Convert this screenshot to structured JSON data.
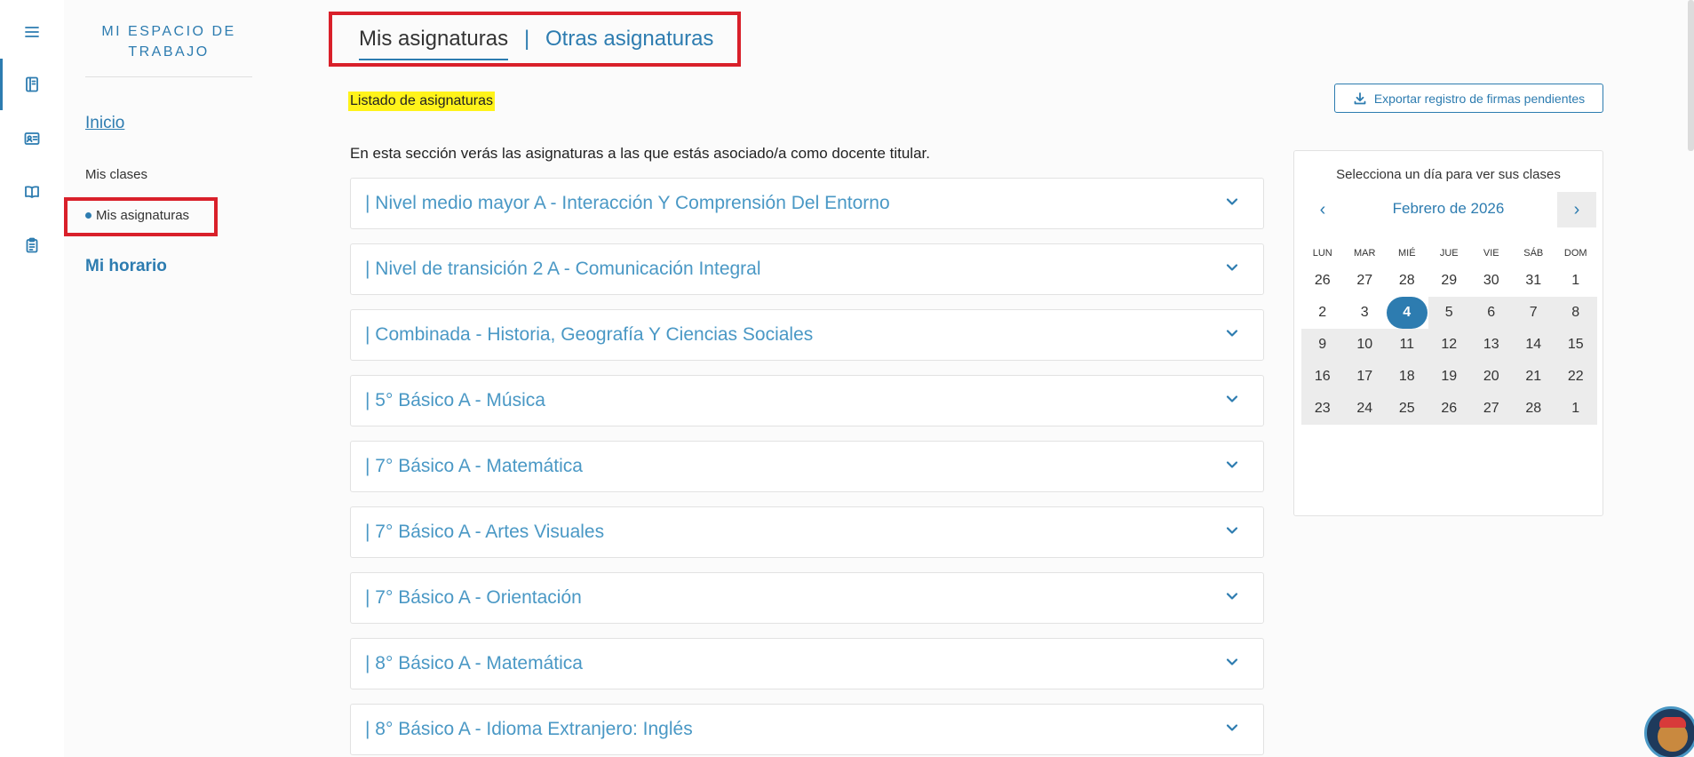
{
  "rail": {
    "icons": [
      "menu-icon",
      "notebook-icon",
      "id-card-icon",
      "book-icon",
      "clipboard-icon"
    ]
  },
  "sidebar": {
    "title": "MI ESPACIO DE TRABAJO",
    "inicio": "Inicio",
    "mis_clases": "Mis clases",
    "mis_asignaturas": "Mis asignaturas",
    "mi_horario": "Mi horario"
  },
  "tabs": {
    "active": "Mis asignaturas",
    "separator": "|",
    "other": "Otras asignaturas"
  },
  "main": {
    "section_title": "Listado de asignaturas",
    "export_label": "Exportar registro de firmas pendientes",
    "description": "En esta sección verás las asignaturas a las que estás asociado/a como docente titular.",
    "subjects": [
      "| Nivel medio mayor A - Interacción Y Comprensión Del Entorno",
      "| Nivel de transición 2 A - Comunicación Integral",
      "| Combinada - Historia, Geografía Y Ciencias Sociales",
      "| 5° Básico A - Música",
      "| 7° Básico A - Matemática",
      "| 7° Básico A - Artes Visuales",
      "| 7° Básico A - Orientación",
      "| 8° Básico A - Matemática",
      "| 8° Básico A - Idioma Extranjero: Inglés"
    ]
  },
  "calendar": {
    "hint": "Selecciona un día para ver sus clases",
    "month": "Febrero de 2026",
    "prev": "‹",
    "next": "›",
    "weekdays": [
      "LUN",
      "MAR",
      "MIÉ",
      "JUE",
      "VIE",
      "SÁB",
      "DOM"
    ],
    "weeks": [
      [
        "26",
        "27",
        "28",
        "29",
        "30",
        "31",
        "1"
      ],
      [
        "2",
        "3",
        "4",
        "5",
        "6",
        "7",
        "8"
      ],
      [
        "9",
        "10",
        "11",
        "12",
        "13",
        "14",
        "15"
      ],
      [
        "16",
        "17",
        "18",
        "19",
        "20",
        "21",
        "22"
      ],
      [
        "23",
        "24",
        "25",
        "26",
        "27",
        "28",
        "1"
      ]
    ],
    "selected_day": "4"
  },
  "colors": {
    "accent": "#2d7cb0",
    "link": "#4a98c5",
    "highlight": "#fff31a",
    "annotation_red": "#d9202a"
  }
}
